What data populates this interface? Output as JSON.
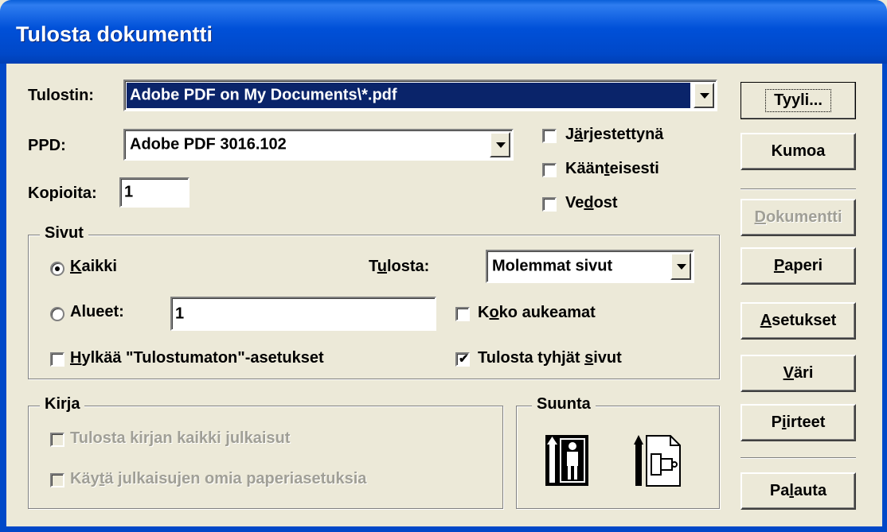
{
  "window": {
    "title": "Tulosta dokumentti"
  },
  "printer": {
    "label": "Tulostin:",
    "value": "Adobe PDF on My Documents\\*.pdf"
  },
  "ppd": {
    "label": "PPD:",
    "value": "Adobe PDF 3016.102"
  },
  "copies": {
    "label": "Kopioita:",
    "value": "1"
  },
  "options": {
    "collate": {
      "pre": "J",
      "key": "ä",
      "post": "rjestettynä",
      "checked": false
    },
    "reverse": {
      "pre": "Kään",
      "key": "t",
      "post": "eisesti",
      "checked": false
    },
    "proofs": {
      "pre": "Ve",
      "key": "d",
      "post": "ost",
      "checked": false
    }
  },
  "pages": {
    "legend": "Sivut",
    "all": {
      "pre": "",
      "key": "K",
      "post": "aikki",
      "selected": true
    },
    "ranges": {
      "label": "Alueet:",
      "value": "1",
      "selected": false
    },
    "print_label": {
      "pre": "T",
      "key": "u",
      "post": "losta:"
    },
    "print_select": {
      "value": "Molemmat sivut"
    },
    "spreads": {
      "pre": "K",
      "key": "o",
      "post": "ko aukeamat",
      "checked": false
    },
    "ignore_nonprinting": {
      "pre": "",
      "key": "H",
      "post": "ylkää \"Tulostumaton\"-asetukset",
      "checked": false
    },
    "blank_pages": {
      "pre": "Tulosta tyhjät ",
      "key": "s",
      "post": "ivut",
      "checked": true
    }
  },
  "book": {
    "legend": "Kirja",
    "all_docs": {
      "pre": "Tulosta kirjan kaikki ",
      "key": "j",
      "post": "ulkaisut",
      "checked": false
    },
    "doc_paper": {
      "pre": "Käy",
      "key": "t",
      "post": "ä julkaisujen omia paperiasetuksia",
      "checked": false
    }
  },
  "orientation": {
    "legend": "Suunta",
    "icons": [
      "portrait-icon",
      "landscape-icon"
    ]
  },
  "buttons": {
    "style": {
      "pre": "Tyyli...",
      "key": "",
      "post": ""
    },
    "cancel": {
      "pre": "Kumoa",
      "key": "",
      "post": ""
    },
    "document": {
      "pre": "",
      "key": "D",
      "post": "okumentti"
    },
    "paper": {
      "pre": "",
      "key": "P",
      "post": "aperi"
    },
    "setup": {
      "pre": "",
      "key": "A",
      "post": "setukset"
    },
    "color": {
      "pre": "",
      "key": "V",
      "post": "äri"
    },
    "features": {
      "pre": "P",
      "key": "i",
      "post": "irteet"
    },
    "return": {
      "pre": "Pa",
      "key": "l",
      "post": "auta"
    }
  },
  "colors": {
    "titlebar": "#0048c8",
    "face": "#ece9d8",
    "disabled_text": "#a09f96"
  }
}
